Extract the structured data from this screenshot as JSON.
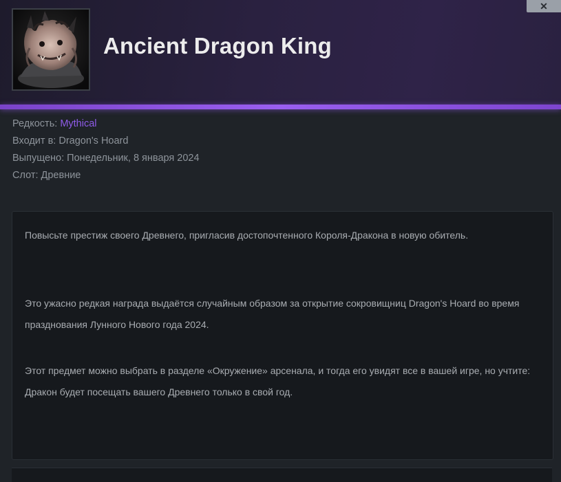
{
  "item": {
    "title": "Ancient Dragon King",
    "image_icon": "dragon-king-portrait-icon"
  },
  "window": {
    "close_label": "✕"
  },
  "meta": {
    "rarity_label": "Редкость: ",
    "rarity_value": "Mythical",
    "set_label": "Входит в: ",
    "set_value": "Dragon's Hoard",
    "released_label": "Выпущено: ",
    "released_value": "Понедельник, 8 января 2024",
    "slot_label": "Слот: ",
    "slot_value": "Древние"
  },
  "description": {
    "p1": "Повысьте престиж своего Древнего, пригласив достопочтенного Короля-Дракона в новую обитель.",
    "p2": "Это ужасно редкая награда выдаётся случайным образом за открытие сокровищниц Dragon's Hoard во время празднования Лунного Нового года 2024.",
    "p3": "Этот предмет можно выбрать в разделе «Окружение» арсенала, и тогда его увидят все в вашей игре, но учтите: Дракон будет посещать вашего Древнего только в свой год."
  },
  "colors": {
    "accent": "#9a5ff0",
    "rarity_mythical": "#8f5be8",
    "background": "#1f2328",
    "panel": "#16191d"
  }
}
